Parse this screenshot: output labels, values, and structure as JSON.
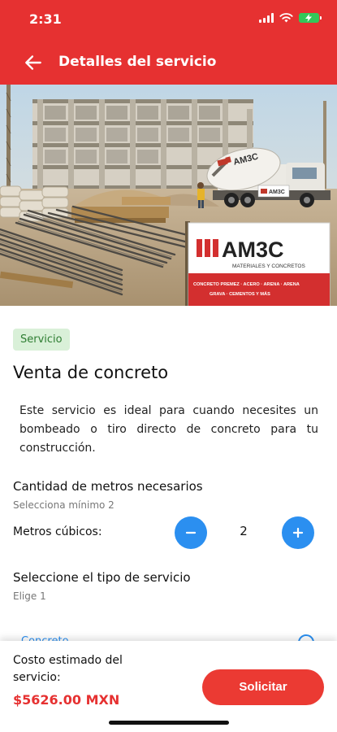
{
  "status_bar": {
    "time": "2:31"
  },
  "header": {
    "title": "Detalles del servicio"
  },
  "hero": {
    "sign_brand": "AM3C",
    "sign_tagline": "MATERIALES Y CONCRETOS",
    "sign_products_1": "CONCRETO PREMEZ · ACERO · ARENA · ARENA",
    "sign_products_2": "GRAVA · CEMENTOS Y MÁS",
    "truck_brand": "AM3C"
  },
  "service": {
    "badge": "Servicio",
    "title": "Venta de concreto",
    "description": "Este servicio es ideal para cuando necesites un bombeado o tiro directo de concreto para tu construcción."
  },
  "quantity": {
    "title": "Cantidad de metros necesarios",
    "subtitle": "Selecciona mínimo 2",
    "label": "Metros cúbicos:",
    "value": "2"
  },
  "service_type": {
    "title": "Seleccione el tipo de servicio",
    "subtitle": "Elige 1",
    "first_option": "Concreto"
  },
  "footer": {
    "cost_label": "Costo estimado del servicio:",
    "cost_value": "$5626.00 MXN",
    "request_label": "Solicitar"
  }
}
